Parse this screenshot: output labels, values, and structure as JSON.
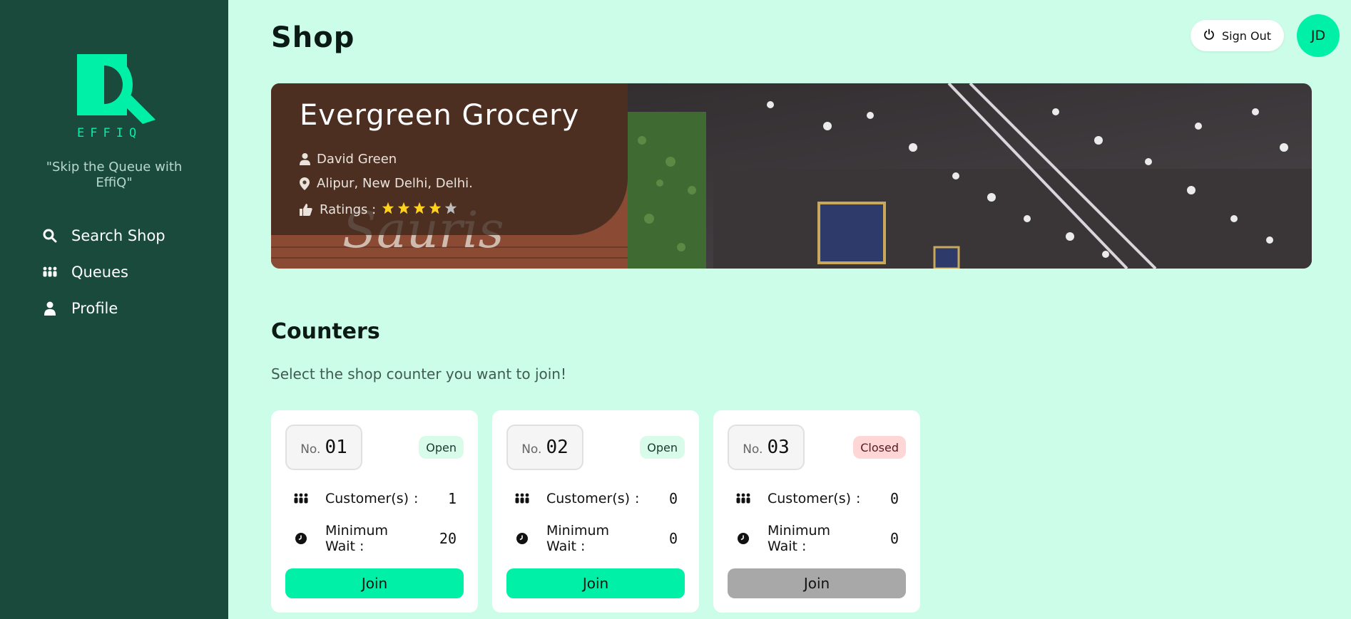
{
  "sidebar": {
    "logo_text": "EFFIQ",
    "tagline": "\"Skip the Queue with EffiQ\"",
    "items": [
      {
        "label": "Search Shop",
        "icon": "search-icon"
      },
      {
        "label": "Queues",
        "icon": "people-icon"
      },
      {
        "label": "Profile",
        "icon": "user-icon"
      }
    ]
  },
  "header": {
    "title": "Shop",
    "signout_label": "Sign Out",
    "avatar_initials": "JD"
  },
  "shop": {
    "name": "Evergreen Grocery",
    "owner": "David Green",
    "address": "Alipur, New Delhi, Delhi.",
    "ratings_label": "Ratings :",
    "rating": 4,
    "rating_max": 5
  },
  "counters": {
    "title": "Counters",
    "subtitle": "Select the shop counter you want to join!",
    "no_label": "No.",
    "customers_label": "Customer(s)",
    "colon": ":",
    "wait_label": "Minimum Wait :",
    "join_label": "Join",
    "items": [
      {
        "number": "01",
        "status": "Open",
        "customers": "1",
        "min_wait": "20"
      },
      {
        "number": "02",
        "status": "Open",
        "customers": "0",
        "min_wait": "0"
      },
      {
        "number": "03",
        "status": "Closed",
        "customers": "0",
        "min_wait": "0"
      }
    ]
  },
  "colors": {
    "sidebar": "#1a4a3b",
    "background": "#ccfde8",
    "accent": "#00f0a8",
    "star": "#ffd21f",
    "closed_badge": "#ffd6d6",
    "disabled_button": "#a8a8a8"
  }
}
